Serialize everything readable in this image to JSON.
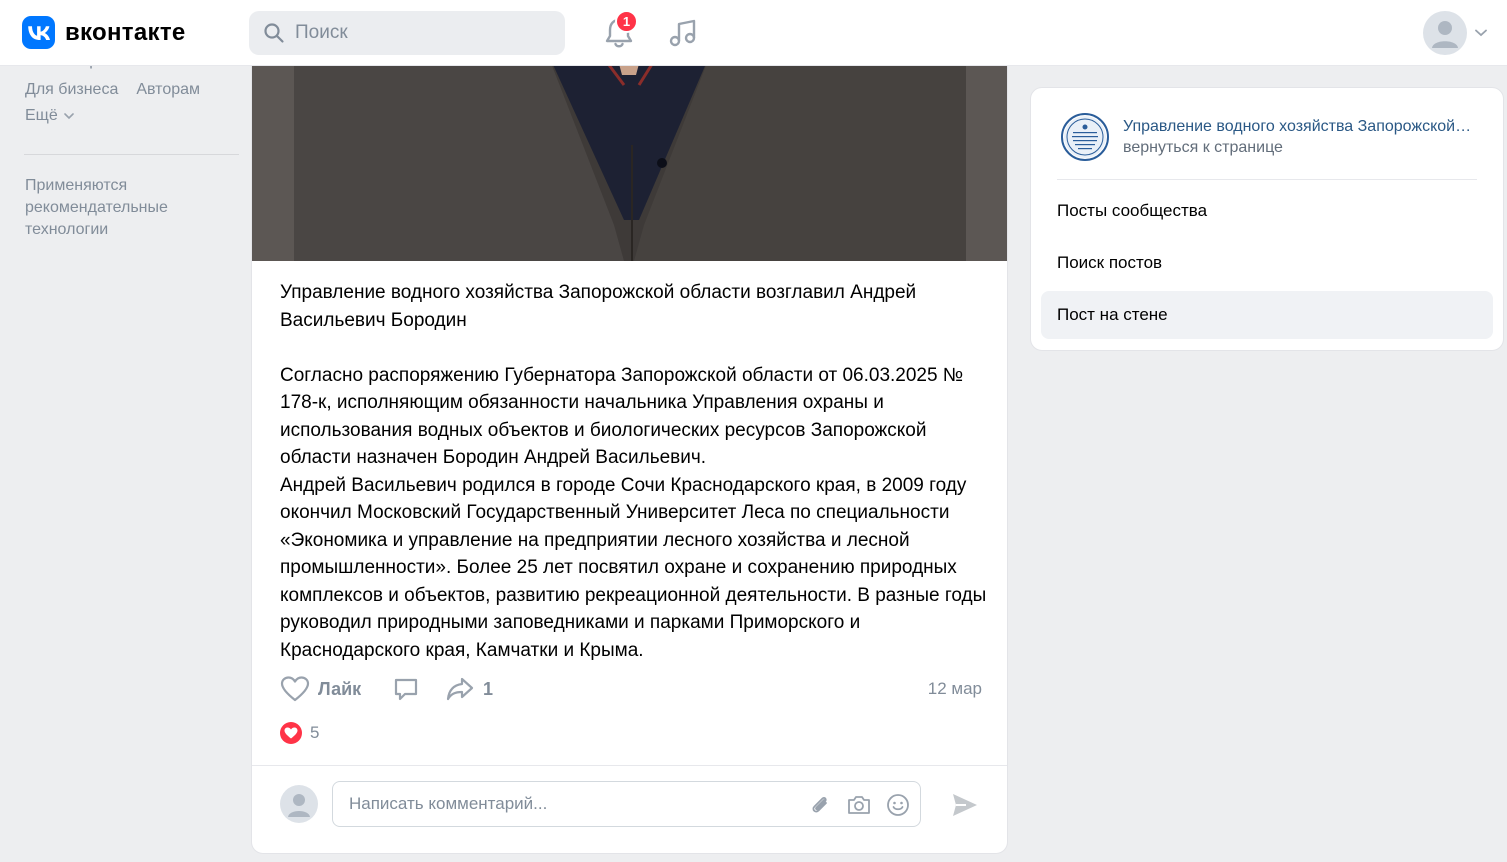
{
  "header": {
    "logo_text": "вконтакте",
    "search_placeholder": "Поиск",
    "notifications_count": "1"
  },
  "left_nav": {
    "cut_row": "Блог   Разработчикам",
    "links": [
      "Для бизнеса",
      "Авторам"
    ],
    "more_label": "Ещё",
    "note": "Применяются рекомендательные технологии"
  },
  "post": {
    "title": "Управление водного хозяйства Запорожской области возглавил Андрей Васильевич Бородин",
    "paragraph1": "Согласно распоряжению Губернатора Запорожской области от 06.03.2025 № 178-к, исполняющим обязанности начальника Управления охраны и использования водных объектов и биологических ресурсов Запорожской области назначен Бородин Андрей Васильевич.",
    "paragraph2": "Андрей Васильевич родился в городе Сочи Краснодарского края, в 2009 году окончил Московский Государственный Университет Леса по специальности «Экономика и управление на предприятии лесного хозяйства и лесной промышленности». Более 25 лет посвятил охране и сохранению природных комплексов и объектов, развитию рекреационной деятельности. В разные годы руководил природными заповедниками и парками Приморского и Краснодарского края, Камчатки и Крыма.",
    "like_label": "Лайк",
    "share_count": "1",
    "date": "12 мар",
    "reactions_count": "5",
    "comment_placeholder": "Написать комментарий..."
  },
  "right_panel": {
    "group_title": "Управление водного хозяйства Запорожской области",
    "group_sub": "вернуться к странице",
    "items": [
      "Посты сообщества",
      "Поиск постов",
      "Пост на стене"
    ],
    "active_index": 2
  },
  "colors": {
    "accent": "#0077ff",
    "link": "#2a5885",
    "badge": "#ff3347",
    "muted": "#818c99"
  }
}
